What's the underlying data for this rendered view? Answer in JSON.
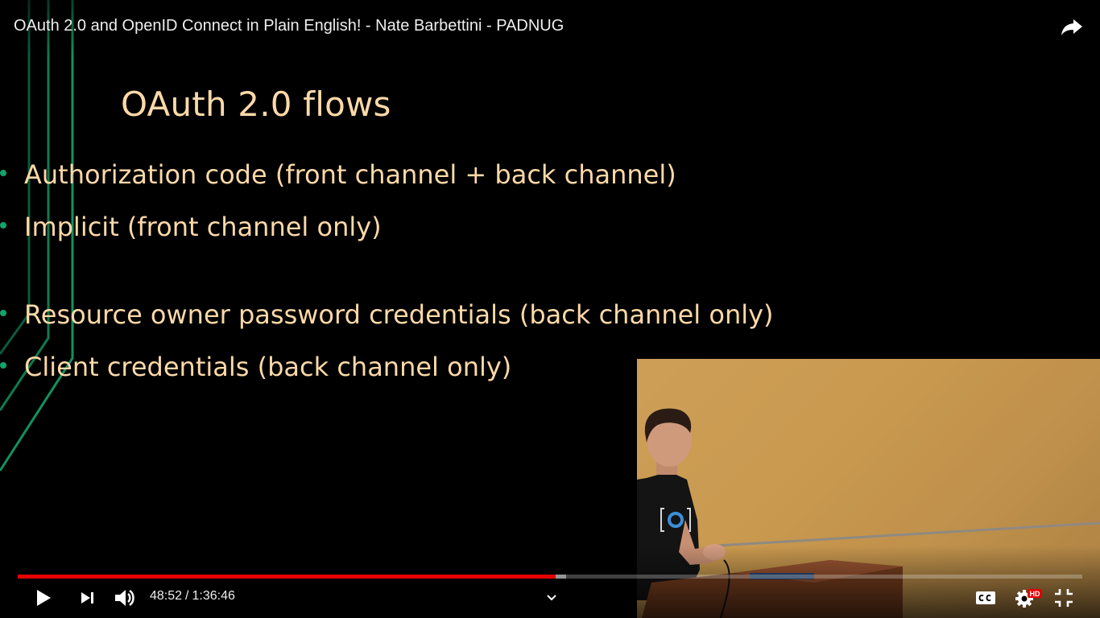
{
  "video": {
    "title": "OAuth 2.0 and OpenID Connect in Plain English! - Nate Barbettini - PADNUG"
  },
  "slide": {
    "title": "OAuth 2.0 flows",
    "bullets": [
      "Authorization code (front channel + back channel)",
      "Implicit (front channel only)",
      "Resource owner password credentials (back channel only)",
      "Client credentials (back channel only)"
    ],
    "colors": {
      "text": "#fcd9a8",
      "bullet": "#13a36c",
      "accent_lines": "#0f7a4e"
    }
  },
  "player": {
    "current_time": "48:52",
    "separator": "/",
    "duration": "1:36:46",
    "progress_fraction": 0.505,
    "buffered_fraction": 0.515,
    "quality_badge": "HD",
    "icons": {
      "share": "share-icon",
      "play": "play-icon",
      "next": "next-icon",
      "volume": "volume-icon",
      "chapters": "chevron-down-icon",
      "captions": "captions-icon",
      "settings": "gear-icon",
      "exit_fullscreen": "exit-fullscreen-icon"
    },
    "colors": {
      "progress": "#e50000",
      "hd_badge": "#e50000"
    }
  }
}
